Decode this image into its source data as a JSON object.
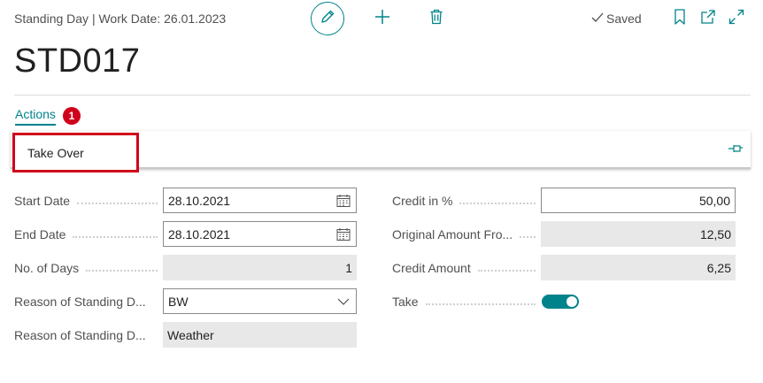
{
  "header": {
    "context": "Standing Day | Work Date: 26.01.2023",
    "saved_label": "Saved",
    "icons": [
      "pencil-icon",
      "plus-icon",
      "trash-icon",
      "check-icon",
      "bookmark-icon",
      "popout-icon",
      "expand-icon"
    ]
  },
  "record": {
    "title": "STD017"
  },
  "actions": {
    "tab_label": "Actions",
    "badge": "1",
    "take_over_label": "Take Over"
  },
  "fields_left": [
    {
      "label": "Start Date",
      "value": "28.10.2021"
    },
    {
      "label": "End Date",
      "value": "28.10.2021"
    },
    {
      "label": "No. of Days",
      "value": "1"
    },
    {
      "label": "Reason of Standing D...",
      "value": "BW"
    },
    {
      "label": "Reason of Standing D...",
      "value": "Weather"
    }
  ],
  "fields_right": [
    {
      "label": "Credit in %",
      "value": "50,00"
    },
    {
      "label": "Original Amount Fro...",
      "value": "12,50"
    },
    {
      "label": "Credit Amount",
      "value": "6,25"
    },
    {
      "label": "Take",
      "value": "on"
    }
  ],
  "colors": {
    "accent": "#00838a",
    "highlight": "#d0021b",
    "readonly_bg": "#e8e8e8"
  }
}
